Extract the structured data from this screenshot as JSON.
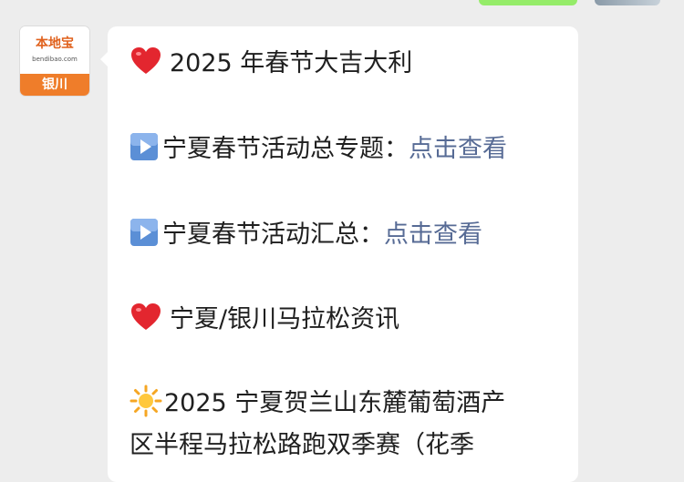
{
  "avatar": {
    "brand": "本地宝",
    "domain": "bendibao.com",
    "city": "银川"
  },
  "message": {
    "line1": "2025 年春节大吉大利",
    "line2_text": "宁夏春节活动总专题：",
    "line2_link": "点击查看",
    "line3_text": "宁夏春节活动汇总：",
    "line3_link": "点击查看",
    "line4": " 宁夏/银川马拉松资讯",
    "line5": "2025 宁夏贺兰山东麓葡萄酒产",
    "line6": "区半程马拉松路跑双季赛（花季"
  },
  "colors": {
    "background": "#ededed",
    "bubble": "#ffffff",
    "link": "#576b95",
    "brand_orange": "#ef7d2a",
    "sent_bubble": "#95ec69"
  },
  "icons": [
    "heart-icon",
    "play-icon",
    "sun-icon"
  ]
}
